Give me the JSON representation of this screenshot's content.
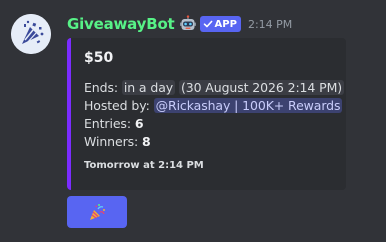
{
  "message": {
    "avatar_icon": "confetti-bot-avatar",
    "username": "GiveawayBot",
    "username_color": "#57f287",
    "emoji_icon": "robot-face-icon",
    "app_tag": {
      "icon": "check-icon",
      "label": "APP",
      "color": "#5865f2"
    },
    "timestamp": "2:14 PM"
  },
  "embed": {
    "accent_color": "#7b2cff",
    "title": "$50",
    "ends": {
      "label": "Ends:",
      "relative": "in a day",
      "absolute": "(30 August 2026 2:14 PM)"
    },
    "hosted": {
      "label": "Hosted by:",
      "mention": "@Rickashay | 100K+ Rewards"
    },
    "entries": {
      "label": "Entries:",
      "value": "6"
    },
    "winners": {
      "label": "Winners:",
      "value": "8"
    },
    "footer": "Tomorrow at 2:14 PM"
  },
  "join_button": {
    "icon": "party-popper-icon",
    "color": "#5865f2"
  }
}
